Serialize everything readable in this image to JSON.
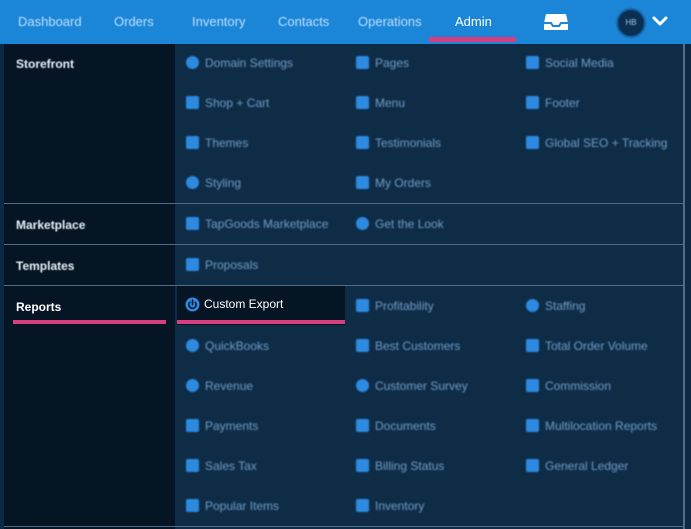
{
  "nav": {
    "items": [
      "Dashboard",
      "Orders",
      "Inventory",
      "Contacts",
      "Operations",
      "Admin"
    ],
    "active": "Admin",
    "avatar_initials": "HB"
  },
  "menu": {
    "sections": {
      "storefront": "Storefront",
      "marketplace": "Marketplace",
      "templates": "Templates",
      "reports": "Reports"
    },
    "storefront_items": [
      "Domain Settings",
      "Pages",
      "Social Media",
      "Shop + Cart",
      "Menu",
      "Footer",
      "Themes",
      "Testimonials",
      "Global SEO + Tracking",
      "Styling",
      "My Orders"
    ],
    "marketplace_items": [
      "TapGoods Marketplace",
      "Get the Look"
    ],
    "templates_items": [
      "Proposals"
    ],
    "reports_items": [
      "Custom Export",
      "Profitability",
      "Staffing",
      "QuickBooks",
      "Best Customers",
      "Total Order Volume",
      "Revenue",
      "Customer Survey",
      "Commission",
      "Payments",
      "Documents",
      "Multilocation Reports",
      "Sales Tax",
      "Billing Status",
      "General Ledger",
      "Popular Items",
      "Inventory"
    ]
  },
  "colors": {
    "nav_bg": "#1b86d8",
    "accent": "#d63e7e",
    "panel_bg": "#0f2c47",
    "label_bg": "#061523",
    "item_icon": "#2d8ae0"
  }
}
